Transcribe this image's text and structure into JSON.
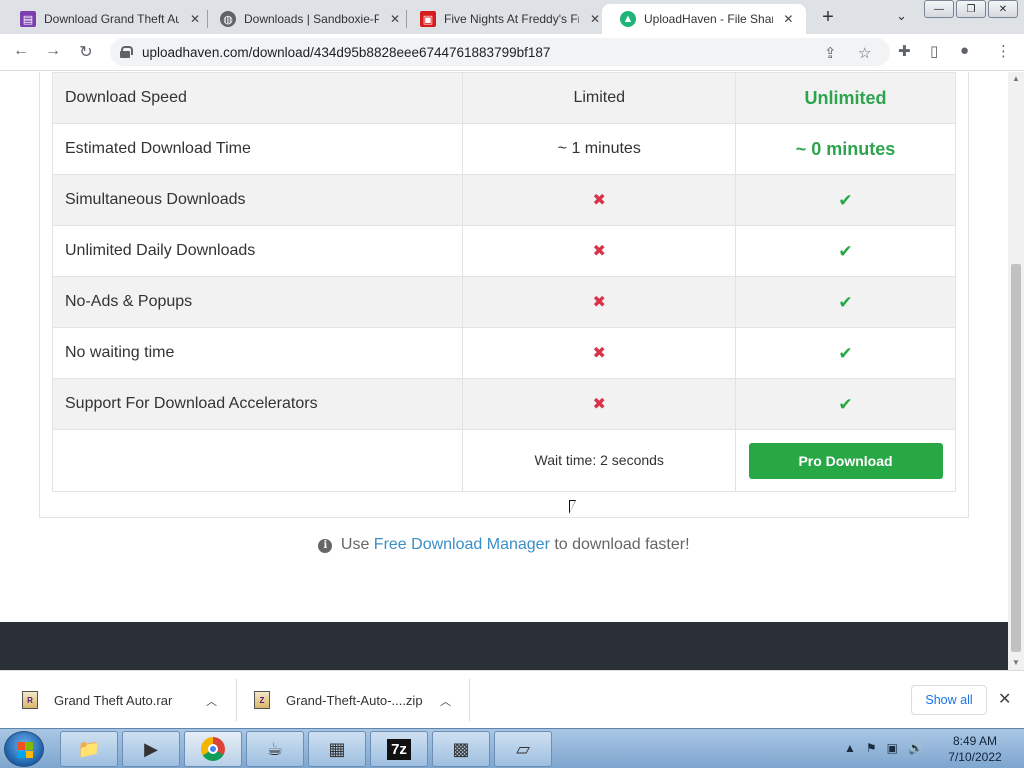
{
  "browser": {
    "tabs": [
      {
        "title": "Download Grand Theft Au",
        "icon": "game-icon",
        "color": "#7b3fb0",
        "active": false
      },
      {
        "title": "Downloads | Sandboxie-P",
        "icon": "globe-icon",
        "color": "#5f6368",
        "active": false
      },
      {
        "title": "Five Nights At Freddy's Fr",
        "icon": "gift-icon",
        "color": "#d81b1b",
        "active": false
      },
      {
        "title": "UploadHaven - File Sharin",
        "icon": "cloud-upload-icon",
        "color": "#1fb57a",
        "active": true
      }
    ],
    "url": "uploadhaven.com/download/434d95b8828eee6744761883799bf187"
  },
  "comparison": {
    "rows": [
      {
        "feature": "Download Speed",
        "free": "Limited",
        "pro": "Unlimited",
        "type": "text"
      },
      {
        "feature": "Estimated Download Time",
        "free": "~ 1 minutes",
        "pro": "~ 0 minutes",
        "type": "text"
      },
      {
        "feature": "Simultaneous Downloads",
        "free": "✖",
        "pro": "✔",
        "type": "icon"
      },
      {
        "feature": "Unlimited Daily Downloads",
        "free": "✖",
        "pro": "✔",
        "type": "icon"
      },
      {
        "feature": "No-Ads & Popups",
        "free": "✖",
        "pro": "✔",
        "type": "icon"
      },
      {
        "feature": "No waiting time",
        "free": "✖",
        "pro": "✔",
        "type": "icon"
      },
      {
        "feature": "Support For Download Accelerators",
        "free": "✖",
        "pro": "✔",
        "type": "icon"
      }
    ],
    "wait_text": "Wait time: 2 seconds",
    "pro_button": "Pro Download"
  },
  "tip": {
    "prefix": "Use",
    "link": "Free Download Manager",
    "suffix": "to download faster!"
  },
  "download_shelf": {
    "items": [
      {
        "name": "Grand Theft Auto.rar",
        "icon_text": "R"
      },
      {
        "name": "Grand-Theft-Auto-....zip",
        "icon_text": "Z"
      }
    ],
    "show_all": "Show all"
  },
  "taskbar": {
    "time": "8:49 AM",
    "date": "7/10/2022",
    "apps": [
      "folder-icon",
      "media-player-icon",
      "chrome-icon",
      "java-icon",
      "control-panel-icon",
      "7zip-icon",
      "network-monitor-icon",
      "notepad-icon"
    ]
  },
  "colors": {
    "pro_green": "#28a745",
    "cross_red": "#d9334a",
    "link_blue": "#3a8fc7",
    "footer_dark": "#2b2f36"
  }
}
